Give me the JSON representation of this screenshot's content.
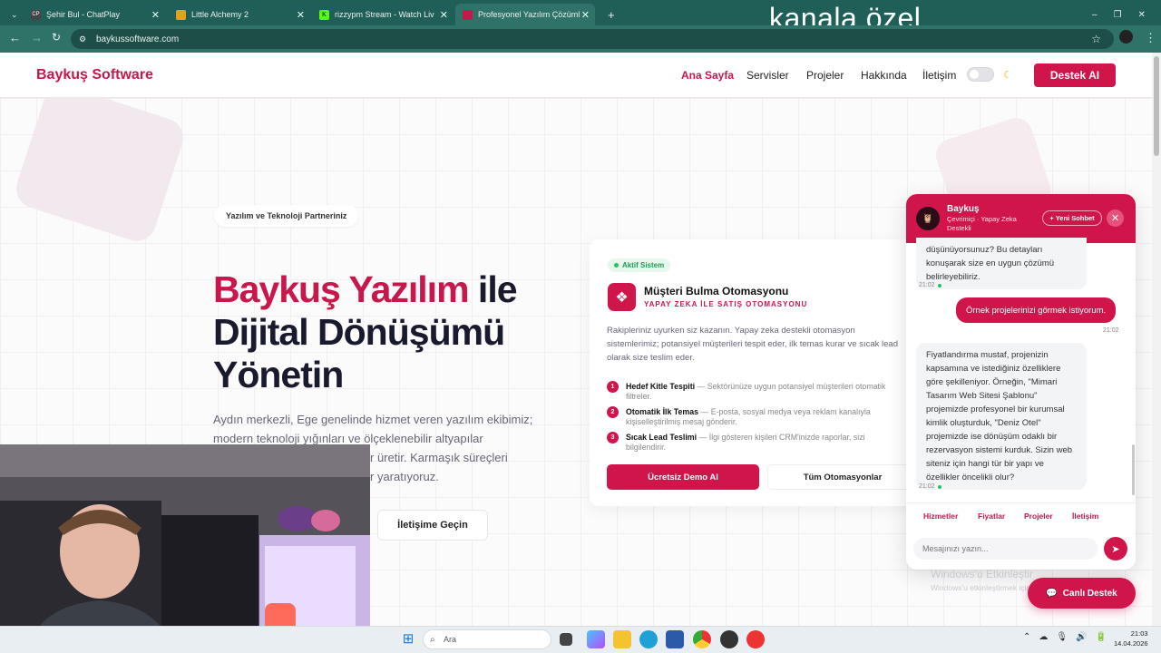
{
  "browser": {
    "tabs": [
      {
        "title": "Şehir Bul - ChatPlay",
        "favicon": "CP"
      },
      {
        "title": "Little Alchemy 2",
        "favicon": "LA"
      },
      {
        "title": "rizzypm Stream - Watch Live on",
        "favicon": "K"
      },
      {
        "title": "Profesyonel Yazılım Çözümleri |",
        "favicon": "B"
      }
    ],
    "url": "baykussoftware.com",
    "overlay_caption": "kanala özel"
  },
  "site": {
    "logo": "Baykuş Software",
    "nav": [
      "Ana Sayfa",
      "Servisler",
      "Projeler",
      "Hakkında",
      "İletişim"
    ],
    "cta": "Destek AI",
    "accent": "#d0154b"
  },
  "hero": {
    "pill": "Yazılım ve Teknoloji Partneriniz",
    "title_pink": "Baykuş Yazılım",
    "title_rest": " ile Dijital Dönüşümü Yönetin",
    "lead": "Aydın merkezli, Ege genelinde hizmet veren yazılım ekibimiz; modern teknoloji yığınları ve ölçeklenebilir altyapılar kullanarak",
    "lead_tail_1": "r üretir. Karmaşık süreçleri",
    "lead_tail_2": "r yaratıyoruz.",
    "contact_button": "İletişime Geçin"
  },
  "card": {
    "badge": "Aktif Sistem",
    "title": "Müşteri Bulma Otomasyonu",
    "subtitle": "YAPAY ZEKA İLE SATIŞ OTOMASYONU",
    "desc": "Rakipleriniz uyurken siz kazanın. Yapay zeka destekli otomasyon sistemlerimiz; potansiyel müşterileri tespit eder, ilk temas kurar ve sıcak lead olarak size teslim eder.",
    "features": [
      {
        "num": "1",
        "title": "Hedef Kitle Tespiti",
        "text": " — Sektörünüze uygun potansiyel müşterileri otomatik filtreler."
      },
      {
        "num": "2",
        "title": "Otomatik İlk Temas",
        "text": " — E-posta, sosyal medya veya reklam kanalıyla kişiselleştirilmiş mesaj gönderir."
      },
      {
        "num": "3",
        "title": "Sıcak Lead Teslimi",
        "text": " — İlgi gösteren kişileri CRM'inizde raporlar, sizi bilgilendirir."
      }
    ],
    "btn_primary": "Ücretsiz Demo Al",
    "btn_secondary": "Tüm Otomasyonlar"
  },
  "chat": {
    "name": "Baykuş",
    "status": "Çevrimiçi · Yapay Zeka Destekli",
    "new_chat": "+ Yeni Sohbet",
    "msg1": "düşünüyorsunuz? Bu detayları konuşarak size en uygun çözümü belirleyebiliriz.",
    "t1": "21:02",
    "user_msg": "Örnek projelerinizi görmek istiyorum.",
    "t2": "21:02",
    "msg2": "Fiyatlandırma mustaf, projenizin kapsamına ve istediğiniz özelliklere göre şekilleniyor. Örneğin, \"Mimari Tasarım Web Sitesi Şablonu\" projemizde profesyonel bir kurumsal kimlik oluşturduk, \"Deniz Otel\" projemizde ise dönüşüm odaklı bir rezervasyon sistemi kurduk. Sizin web siteniz için hangi tür bir yapı ve özellikler öncelikli olur?",
    "t3": "21:02",
    "quick": [
      "Hizmetler",
      "Fiyatlar",
      "Projeler",
      "İletişim"
    ],
    "input_placeholder": "Mesajınızı yazın...",
    "live_support": "Canlı Destek"
  },
  "watermark": {
    "line1": "Windows'u Etkinleştir",
    "line2": "Windows'u etkinleştirmek için Ayarlar'a gidin."
  },
  "taskbar": {
    "search": "Ara",
    "time": "21:03",
    "date": "14.04.2026"
  }
}
